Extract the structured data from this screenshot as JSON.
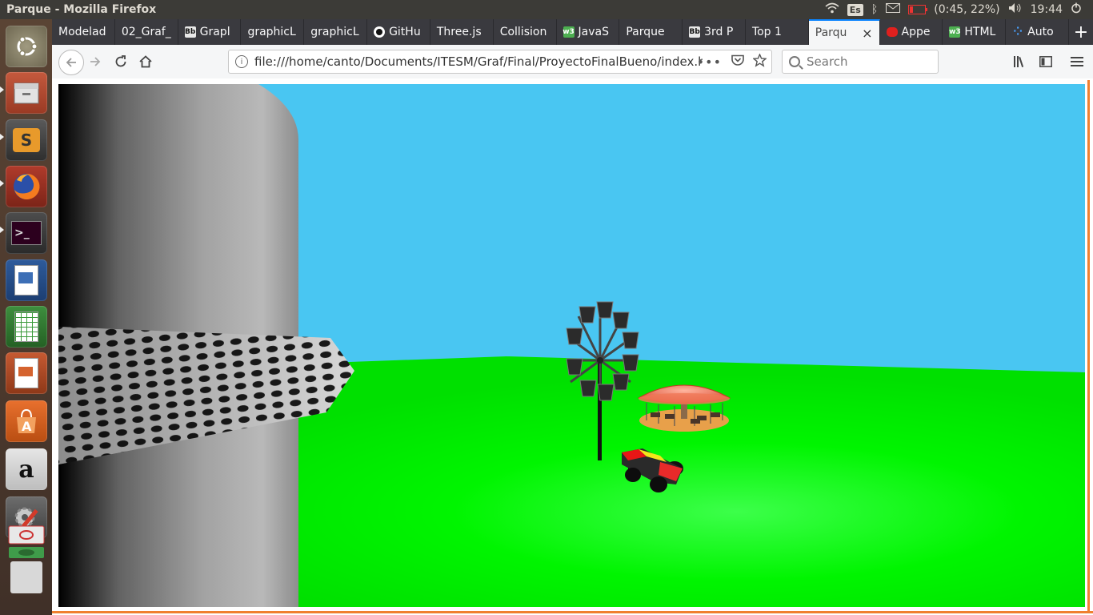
{
  "window": {
    "title": "Parque - Mozilla Firefox"
  },
  "system": {
    "keyboard": "Es",
    "battery": "(0:45, 22%)",
    "battery_level": 0.22,
    "clock": "19:44"
  },
  "launcher": [
    {
      "icon": "ubuntu-dash-icon"
    },
    {
      "icon": "files-icon"
    },
    {
      "icon": "sublime-text-icon"
    },
    {
      "icon": "firefox-icon"
    },
    {
      "icon": "terminal-icon"
    },
    {
      "icon": "writer-icon"
    },
    {
      "icon": "calc-icon"
    },
    {
      "icon": "impress-icon"
    },
    {
      "icon": "software-center-icon"
    },
    {
      "icon": "amazon-icon"
    },
    {
      "icon": "settings-icon"
    },
    {
      "icon": "trash-icon"
    }
  ],
  "tabs": [
    {
      "label": "Modelad",
      "icon": ""
    },
    {
      "label": "02_Graf_",
      "icon": ""
    },
    {
      "label": "Grapl",
      "icon": "Bb"
    },
    {
      "label": "graphicL",
      "icon": ""
    },
    {
      "label": "graphicL",
      "icon": ""
    },
    {
      "label": "GitHu",
      "icon": "gh"
    },
    {
      "label": "Three.js",
      "icon": ""
    },
    {
      "label": "Collision",
      "icon": ""
    },
    {
      "label": "JavaS",
      "icon": "w3"
    },
    {
      "label": "Parque",
      "icon": ""
    },
    {
      "label": "3rd P",
      "icon": "Bb"
    },
    {
      "label": "Top 1",
      "icon": ""
    },
    {
      "label": "Parqu",
      "icon": "",
      "active": true
    },
    {
      "label": "Appe",
      "icon": "oc"
    },
    {
      "label": "HTML",
      "icon": "w3"
    },
    {
      "label": "Auto",
      "icon": "dots"
    }
  ],
  "nav": {
    "url": "file:///home/canto/Documents/ITESM/Graf/Final/ProyectoFinalBueno/index.h",
    "search_placeholder": "Search",
    "new_tab": "+"
  },
  "colors": {
    "sky": "#49c6f2",
    "ground": "#00ff00",
    "accent": "#0a84ff",
    "frame": "#f08030"
  }
}
